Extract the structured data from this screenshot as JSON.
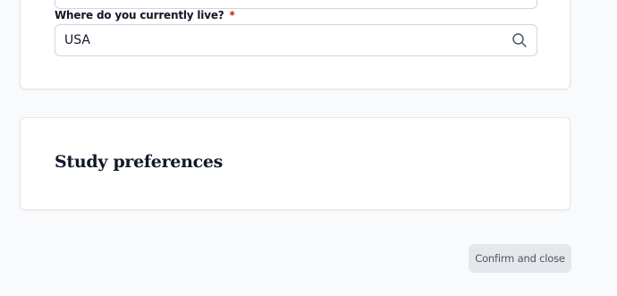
{
  "residence": {
    "label": "Where do you currently live?",
    "required_marker": "*",
    "value": "USA",
    "icon": "search-icon"
  },
  "study_preferences": {
    "title": "Study preferences"
  },
  "actions": {
    "confirm_label": "Confirm and close"
  },
  "colors": {
    "required": "#b91c1c",
    "button_bg": "#e5e7eb",
    "button_text": "#4b5563"
  }
}
